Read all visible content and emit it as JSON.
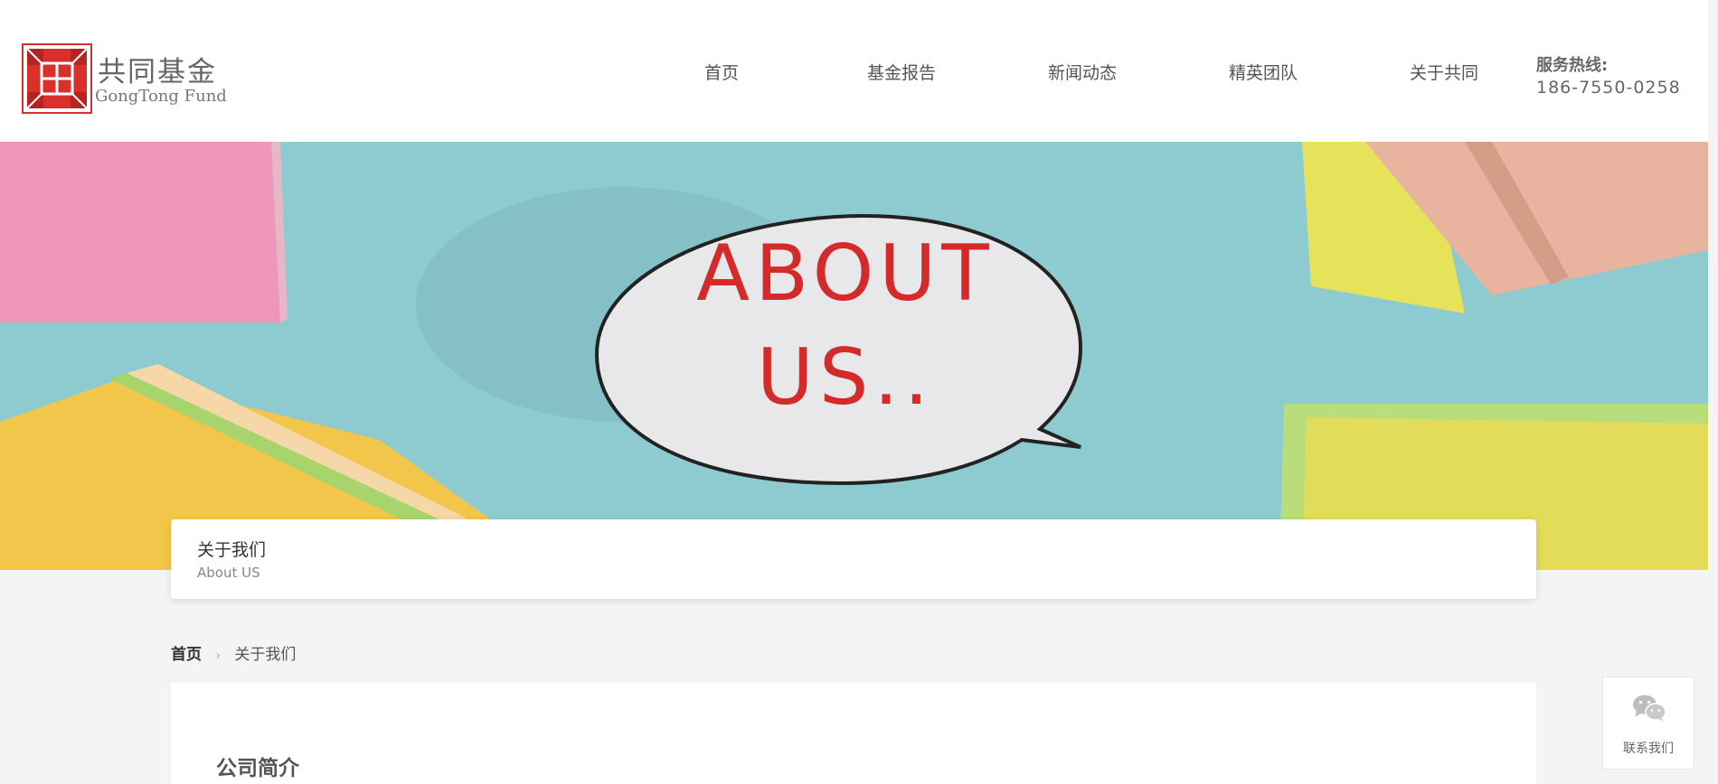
{
  "header": {
    "logo_cn": "共同基金",
    "logo_en": "GongTong Fund",
    "nav": [
      {
        "label": "首页"
      },
      {
        "label": "基金报告"
      },
      {
        "label": "新闻动态"
      },
      {
        "label": "精英团队"
      },
      {
        "label": "关于共同"
      }
    ],
    "hotline_label": "服务热线:",
    "hotline_number": "186-7550-0258"
  },
  "banner": {
    "bubble_line1": "ABOUT",
    "bubble_line2": "US.."
  },
  "title_card": {
    "title_cn": "关于我们",
    "title_en": "About US"
  },
  "breadcrumb": {
    "home": "首页",
    "separator": "›",
    "current": "关于我们"
  },
  "content": {
    "section_title": "公司简介"
  },
  "contact": {
    "label": "联系我们",
    "icon": "wechat-icon"
  },
  "colors": {
    "brand_red": "#d8302a",
    "banner_bg": "#8ecbd0",
    "bubble_text": "#d42a2a"
  }
}
